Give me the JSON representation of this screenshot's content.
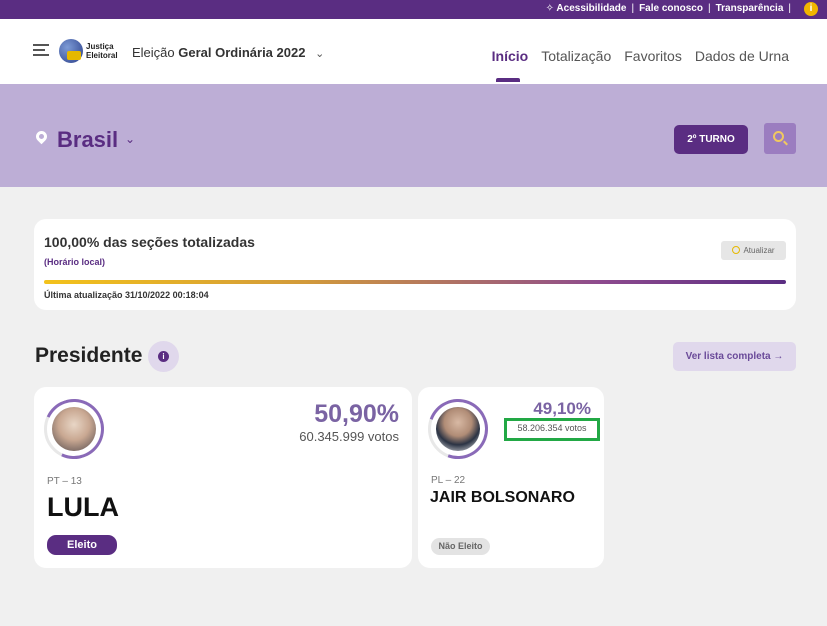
{
  "topbar": {
    "links": [
      "Acessibilidade",
      "Fale conosco",
      "Transparência"
    ],
    "separator": "|",
    "info_glyph": "i"
  },
  "header": {
    "logo_line1": "Justiça",
    "logo_line2": "Eleitoral",
    "election_prefix": "Eleição",
    "election_name": "Geral Ordinária 2022",
    "nav": [
      "Início",
      "Totalização",
      "Favoritos",
      "Dados de Urna"
    ]
  },
  "band": {
    "region": "Brasil",
    "turno_button": "2º TURNO"
  },
  "progress": {
    "title": "100,00% das seções totalizadas",
    "local_time": "(Horário local)",
    "refresh_button": "Atualizar",
    "fill_fraction": 1.0,
    "last_update": "Última atualização 31/10/2022 00:18:04"
  },
  "section": {
    "title": "Presidente",
    "info_glyph": "i",
    "list_button": "Ver lista completa →"
  },
  "candidates": [
    {
      "percent": "50,90%",
      "votes": "60.345.999 votos",
      "party": "PT – 13",
      "name": "LULA",
      "status": "Eleito"
    },
    {
      "percent": "49,10%",
      "votes": "58.206.354 votos",
      "party": "PL – 22",
      "name": "JAIR BOLSONARO",
      "status": "Não Eleito"
    }
  ],
  "colors": {
    "brand": "#5a2d82",
    "band": "#bdaed6",
    "highlight_box": "#22a845",
    "info_dot": "#f0b400"
  }
}
